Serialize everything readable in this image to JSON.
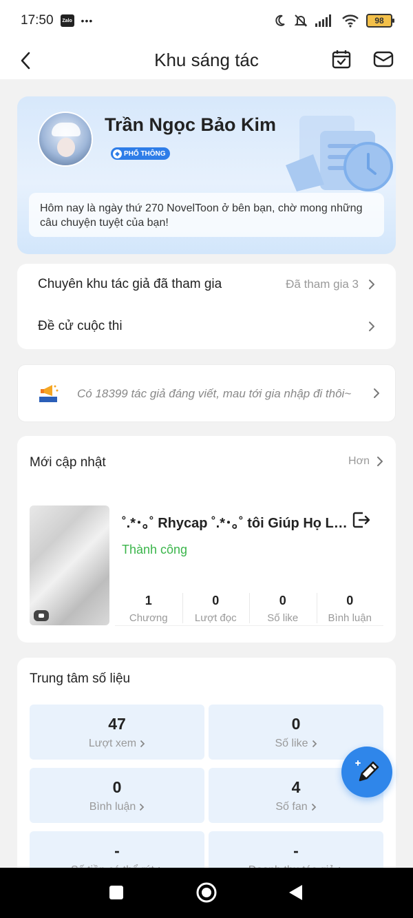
{
  "status_bar": {
    "time": "17:50",
    "app_badge": "Zalo",
    "more": "•••",
    "battery": "98"
  },
  "header": {
    "title": "Khu sáng tác"
  },
  "profile": {
    "name": "Trần Ngọc Bảo Kim",
    "badge": "PHỔ THÔNG",
    "welcome": "Hôm nay là ngày thứ 270 NovelToon ở bên bạn, chờ mong những câu chuyện tuyệt của bạn!"
  },
  "menu": {
    "items": [
      {
        "label": "Chuyên khu tác giả đã tham gia",
        "value": "Đã tham gia 3"
      },
      {
        "label": "Đề cử cuộc thi",
        "value": ""
      }
    ]
  },
  "banner": {
    "text": "Có 18399 tác giả đáng viết, mau tới gia nhập đi thôi~"
  },
  "updates": {
    "title": "Mới cập nhật",
    "more": "Hơn",
    "book": {
      "title": "˚.*･｡˚ Rhycap ˚.*･｡˚ tôi Giúp Họ Làm Lành",
      "status": "Thành công",
      "stats": [
        {
          "value": "1",
          "label": "Chương"
        },
        {
          "value": "0",
          "label": "Lượt đọc"
        },
        {
          "value": "0",
          "label": "Số like"
        },
        {
          "value": "0",
          "label": "Bình luận"
        }
      ]
    }
  },
  "data_center": {
    "title": "Trung tâm số liệu",
    "tiles": [
      {
        "value": "47",
        "label": "Lượt xem"
      },
      {
        "value": "0",
        "label": "Số like"
      },
      {
        "value": "0",
        "label": "Bình luận"
      },
      {
        "value": "4",
        "label": "Số fan"
      },
      {
        "value": "-",
        "label": "Số tiền có thể rút"
      },
      {
        "value": "-",
        "label": "Doanh thu tác giả"
      }
    ]
  },
  "colors": {
    "accent": "#2f86ea",
    "success": "#3ab54a",
    "tile_bg": "#e9f2fc"
  }
}
